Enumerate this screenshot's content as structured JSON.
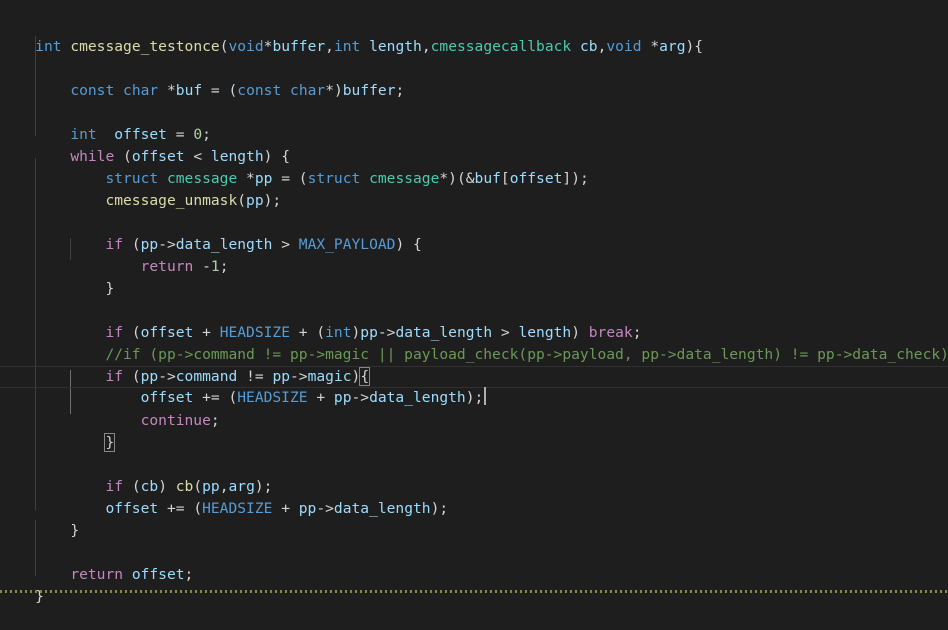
{
  "code": {
    "line_1": {
      "t1": "int",
      "t2": " ",
      "t3": "cmessage_testonce",
      "t4": "(",
      "t5": "void",
      "t6": "*",
      "t7": "buffer",
      "t8": ",",
      "t9": "int",
      "t10": " ",
      "t11": "length",
      "t12": ",",
      "t13": "cmessagecallback",
      "t14": " ",
      "t15": "cb",
      "t16": ",",
      "t17": "void",
      "t18": " *",
      "t19": "arg",
      "t20": "){"
    },
    "line_3": {
      "t1": "    ",
      "t2": "const",
      "t3": " ",
      "t4": "char",
      "t5": " *",
      "t6": "buf",
      "t7": " = (",
      "t8": "const",
      "t9": " ",
      "t10": "char",
      "t11": "*)",
      "t12": "buffer",
      "t13": ";"
    },
    "line_5": {
      "t1": "    ",
      "t2": "int",
      "t3": "  ",
      "t4": "offset",
      "t5": " = ",
      "t6": "0",
      "t7": ";"
    },
    "line_6": {
      "t1": "    ",
      "t2": "while",
      "t3": " (",
      "t4": "offset",
      "t5": " < ",
      "t6": "length",
      "t7": ") {"
    },
    "line_7": {
      "t1": "        ",
      "t2": "struct",
      "t3": " ",
      "t4": "cmessage",
      "t5": " *",
      "t6": "pp",
      "t7": " = (",
      "t8": "struct",
      "t9": " ",
      "t10": "cmessage",
      "t11": "*)(&",
      "t12": "buf",
      "t13": "[",
      "t14": "offset",
      "t15": "]);"
    },
    "line_8": {
      "t1": "        ",
      "t2": "cmessage_unmask",
      "t3": "(",
      "t4": "pp",
      "t5": ");"
    },
    "line_10": {
      "t1": "        ",
      "t2": "if",
      "t3": " (",
      "t4": "pp",
      "t5": "->",
      "t6": "data_length",
      "t7": " > ",
      "t8": "MAX_PAYLOAD",
      "t9": ") {"
    },
    "line_11": {
      "t1": "            ",
      "t2": "return",
      "t3": " -",
      "t4": "1",
      "t5": ";"
    },
    "line_12": {
      "t1": "        ",
      "t2": "}"
    },
    "line_14": {
      "t1": "        ",
      "t2": "if",
      "t3": " (",
      "t4": "offset",
      "t5": " + ",
      "t6": "HEADSIZE",
      "t7": " + (",
      "t8": "int",
      "t9": ")",
      "t10": "pp",
      "t11": "->",
      "t12": "data_length",
      "t13": " > ",
      "t14": "length",
      "t15": ") ",
      "t16": "break",
      "t17": ";"
    },
    "line_15": {
      "t1": "        ",
      "t2": "//if (pp->command != pp->magic || payload_check(pp->payload, pp->data_length) != pp->data_check) {"
    },
    "line_16": {
      "t1": "        ",
      "t2": "if",
      "t3": " (",
      "t4": "pp",
      "t5": "->",
      "t6": "command",
      "t7": " != ",
      "t8": "pp",
      "t9": "->",
      "t10": "magic",
      "t11": ")",
      "t12": "{"
    },
    "line_17": {
      "t1": "            ",
      "t2": "offset",
      "t3": " += (",
      "t4": "HEADSIZE",
      "t5": " + ",
      "t6": "pp",
      "t7": "->",
      "t8": "data_length",
      "t9": ");"
    },
    "line_18": {
      "t1": "            ",
      "t2": "continue",
      "t3": ";"
    },
    "line_19": {
      "t1": "        ",
      "t2": "}"
    },
    "line_21": {
      "t1": "        ",
      "t2": "if",
      "t3": " (",
      "t4": "cb",
      "t5": ") ",
      "t6": "cb",
      "t7": "(",
      "t8": "pp",
      "t9": ",",
      "t10": "arg",
      "t11": ");"
    },
    "line_22": {
      "t1": "        ",
      "t2": "offset",
      "t3": " += (",
      "t4": "HEADSIZE",
      "t5": " + ",
      "t6": "pp",
      "t7": "->",
      "t8": "data_length",
      "t9": ");"
    },
    "line_23": {
      "t1": "    ",
      "t2": "}"
    },
    "line_25": {
      "t1": "    ",
      "t2": "return",
      "t3": " ",
      "t4": "offset",
      "t5": ";"
    },
    "line_26": {
      "t1": "}"
    }
  },
  "colors": {
    "background": "#1e1e1e",
    "keyword": "#569cd6",
    "control": "#c586c0",
    "function": "#dcdcaa",
    "type": "#4ec9b0",
    "variable": "#9cdcfe",
    "number": "#b5cea8",
    "comment": "#6a9955"
  }
}
